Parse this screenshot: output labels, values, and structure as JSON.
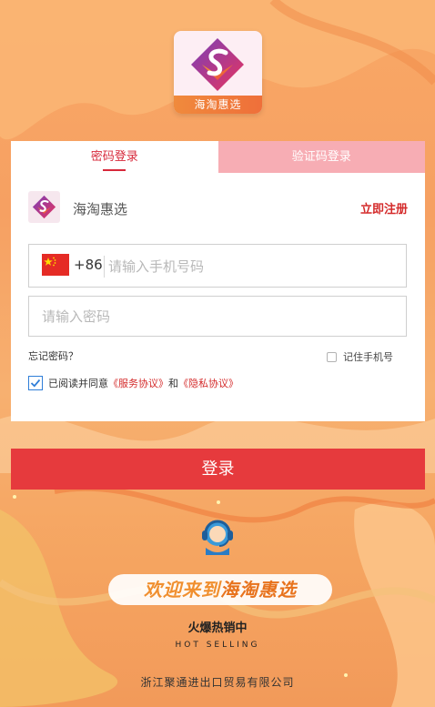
{
  "app": {
    "logo_text": "海淘惠选"
  },
  "tabs": [
    {
      "label": "密码登录",
      "active": true
    },
    {
      "label": "验证码登录",
      "active": false
    }
  ],
  "shop": {
    "name": "海淘惠选",
    "register_label": "立即注册"
  },
  "phone": {
    "country_code": "+86",
    "placeholder": "请输入手机号码",
    "value": ""
  },
  "password": {
    "placeholder": "请输入密码",
    "value": ""
  },
  "links": {
    "forgot": "忘记密码？",
    "remember_label": "记住手机号"
  },
  "agreement": {
    "prefix": "已阅读并同意",
    "service": "《服务协议》",
    "and": "和",
    "privacy": "《隐私协议》",
    "checked": true
  },
  "login_button": "登录",
  "footer": {
    "welcome_prefix": "欢迎来到",
    "welcome_brand": "海淘惠选",
    "hot_cn": "火爆热销中",
    "hot_en": "HOT SELLING",
    "company": "浙江聚通进出口贸易有限公司"
  },
  "colors": {
    "accent": "#e63a3d",
    "tab_inactive": "#f7adb4",
    "link": "#d42b2b"
  }
}
